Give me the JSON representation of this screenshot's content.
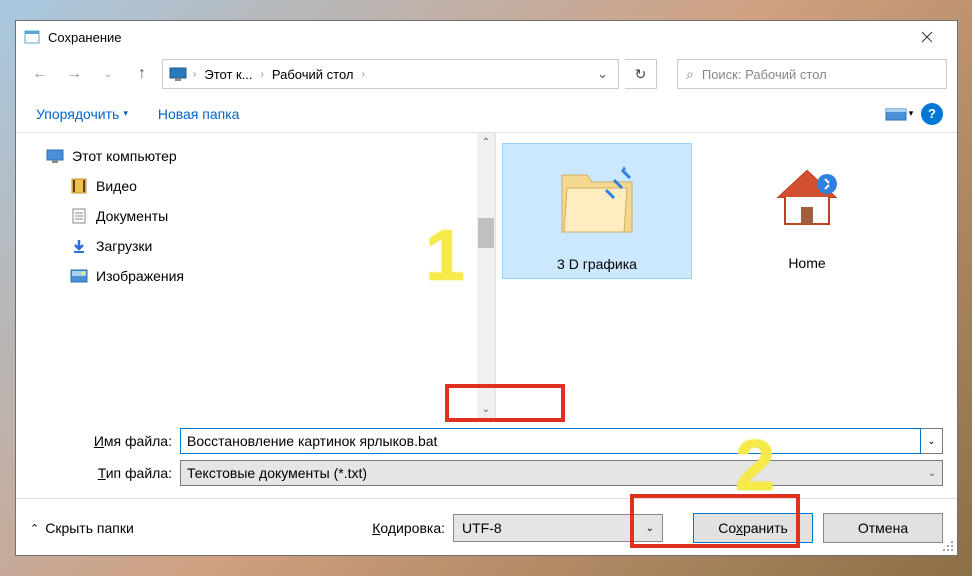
{
  "window": {
    "title": "Сохранение"
  },
  "nav": {
    "seg1": "Этот к...",
    "seg2": "Рабочий стол",
    "search_placeholder": "Поиск: Рабочий стол"
  },
  "toolbar": {
    "organize": "Упорядочить",
    "newfolder": "Новая папка"
  },
  "tree": {
    "root": "Этот компьютер",
    "items": [
      "Видео",
      "Документы",
      "Загрузки",
      "Изображения"
    ]
  },
  "files": {
    "items": [
      {
        "name": "3 D графика"
      },
      {
        "name": "Home"
      }
    ]
  },
  "form": {
    "filename_label_u": "И",
    "filename_label_rest": "мя файла:",
    "filename": "Восстановление картинок ярлыков.bat",
    "filetype_label_u": "Т",
    "filetype_label_rest": "ип файла:",
    "filetype": "Текстовые документы (*.txt)"
  },
  "footer": {
    "hide": "Скрыть папки",
    "encoding_label_u": "К",
    "encoding_label_rest": "одировка:",
    "encoding": "UTF-8",
    "save_u": "х",
    "save_pre": "Со",
    "save_post": "ранить",
    "cancel": "Отмена"
  },
  "annotations": {
    "n1": "1",
    "n2": "2"
  }
}
